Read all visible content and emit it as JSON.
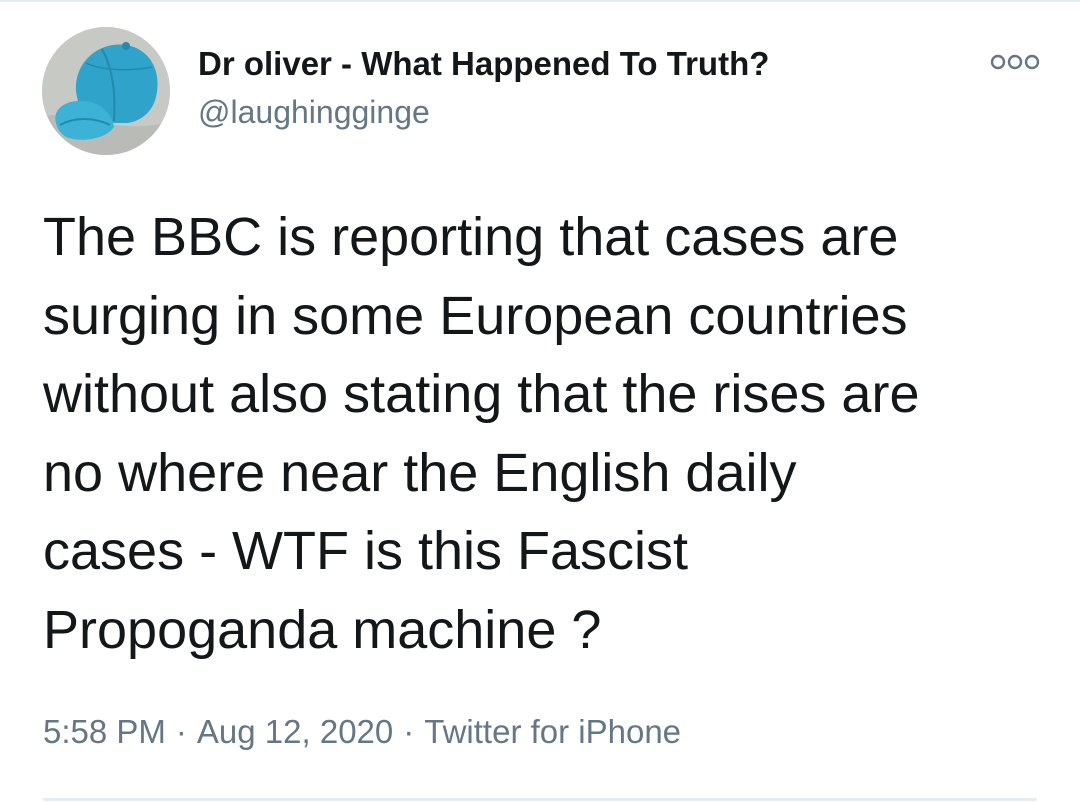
{
  "tweet": {
    "author": {
      "display_name": "Dr oliver - What Happened To Truth?",
      "handle": "@laughingginge",
      "avatar_icon": "blue-cap-photo"
    },
    "more_icon": "more-options-icon",
    "text": "The BBC is reporting that cases are\nsurging in some European countries\nwithout also stating that the rises are\nno where near the English daily\ncases - WTF is this Fascist\nPropoganda machine ?",
    "time": "5:58 PM",
    "separator": "·",
    "date": "Aug 12, 2020",
    "source": "Twitter for iPhone"
  },
  "colors": {
    "text_primary": "#14171a",
    "text_secondary": "#657786",
    "divider": "#e6ecf0",
    "avatar_cap": "#2fa3c9"
  }
}
